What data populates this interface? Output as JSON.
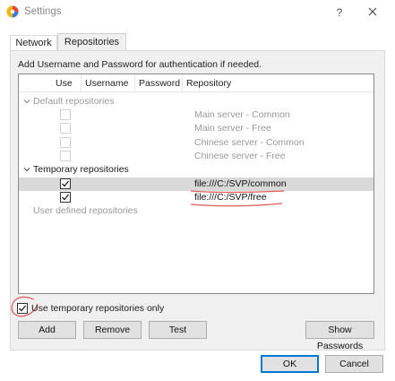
{
  "window": {
    "title": "Settings",
    "help_glyph": "?",
    "icon": "app-logo-icon"
  },
  "tabs": [
    {
      "label": "Network",
      "active": false
    },
    {
      "label": "Repositories",
      "active": true
    }
  ],
  "panel": {
    "intro": "Add Username and Password for authentication if needed."
  },
  "table": {
    "columns": [
      "Use",
      "Username",
      "Password",
      "Repository"
    ],
    "groups": {
      "default": {
        "label": "Default repositories",
        "rows": [
          {
            "checked": false,
            "repository": "Main server - Common"
          },
          {
            "checked": false,
            "repository": "Main server - Free"
          },
          {
            "checked": false,
            "repository": "Chinese server - Common"
          },
          {
            "checked": false,
            "repository": "Chinese server - Free"
          }
        ]
      },
      "temporary": {
        "label": "Temporary repositories",
        "rows": [
          {
            "checked": true,
            "repository": "file:///C:/SVP/common",
            "selected": true
          },
          {
            "checked": true,
            "repository": "file:///C:/SVP/free",
            "selected": false
          }
        ]
      },
      "user": {
        "label": "User defined repositories"
      }
    }
  },
  "options": {
    "use_temp_only_label": "Use temporary repositories only",
    "use_temp_only_checked": true
  },
  "buttons": {
    "add": "Add",
    "remove": "Remove",
    "test": "Test",
    "show_passwords": "Show Passwords",
    "ok": "OK",
    "cancel": "Cancel"
  },
  "colors": {
    "annotation": "#e05a5a",
    "default_button_border": "#0078d7"
  }
}
